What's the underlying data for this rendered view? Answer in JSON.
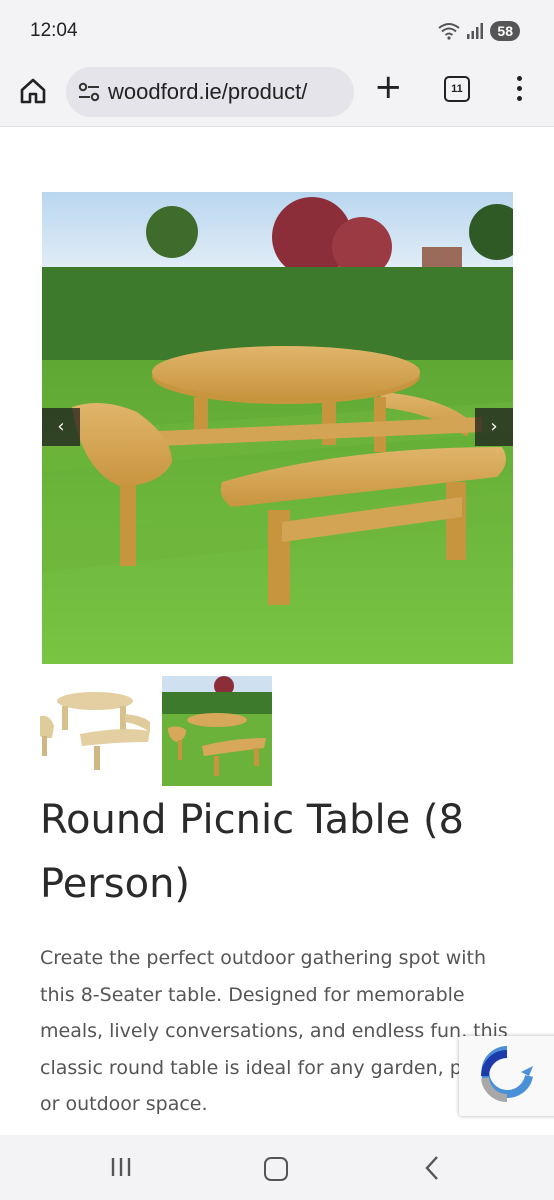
{
  "status": {
    "time": "12:04",
    "battery": "58"
  },
  "browser": {
    "url": "woodford.ie/product/",
    "tab_count": "11"
  },
  "gallery": {
    "prev_label": "‹",
    "next_label": "›"
  },
  "product": {
    "title": "Round Picnic Table (8 Person)",
    "description": "Create the perfect outdoor gathering spot with this 8-Seater table. Designed for memorable meals, lively conversations, and endless fun, this classic round table is ideal for any garden, patio, or outdoor space."
  }
}
